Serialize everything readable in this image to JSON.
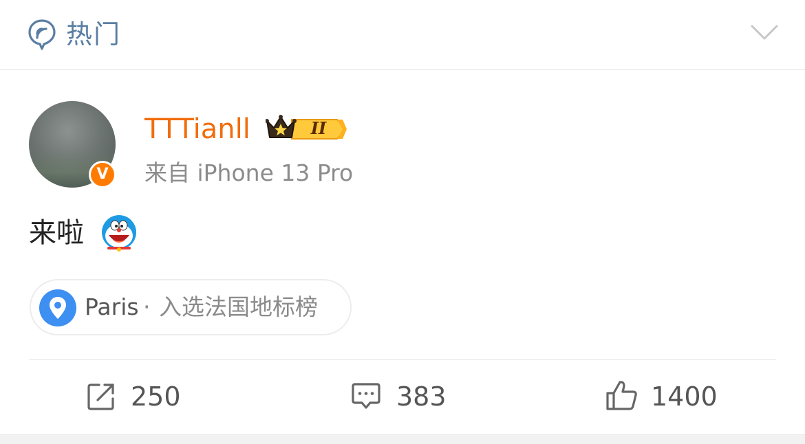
{
  "header": {
    "title": "热门",
    "icon": "hot-topic-icon",
    "collapse_icon": "chevron-down-icon"
  },
  "post": {
    "author": {
      "name": "TTTianll",
      "verified": true,
      "verified_badge_text": "V",
      "vip_level": "II",
      "source": "来自 iPhone 13 Pro"
    },
    "text": "来啦",
    "emoji": "doraemon-emoji",
    "location": {
      "name": "Paris",
      "separator": "·",
      "description": "入选法国地标榜"
    }
  },
  "actions": {
    "repost": {
      "icon": "repost-icon",
      "count": "250"
    },
    "comment": {
      "icon": "comment-icon",
      "count": "383"
    },
    "like": {
      "icon": "thumbs-up-icon",
      "count": "1400"
    }
  },
  "colors": {
    "username": "#f26c0d",
    "header_title": "#5a7ea3",
    "verified_badge": "#ff7b00",
    "location_pin": "#3d8ff2",
    "secondary_text": "#8b8b8b"
  }
}
